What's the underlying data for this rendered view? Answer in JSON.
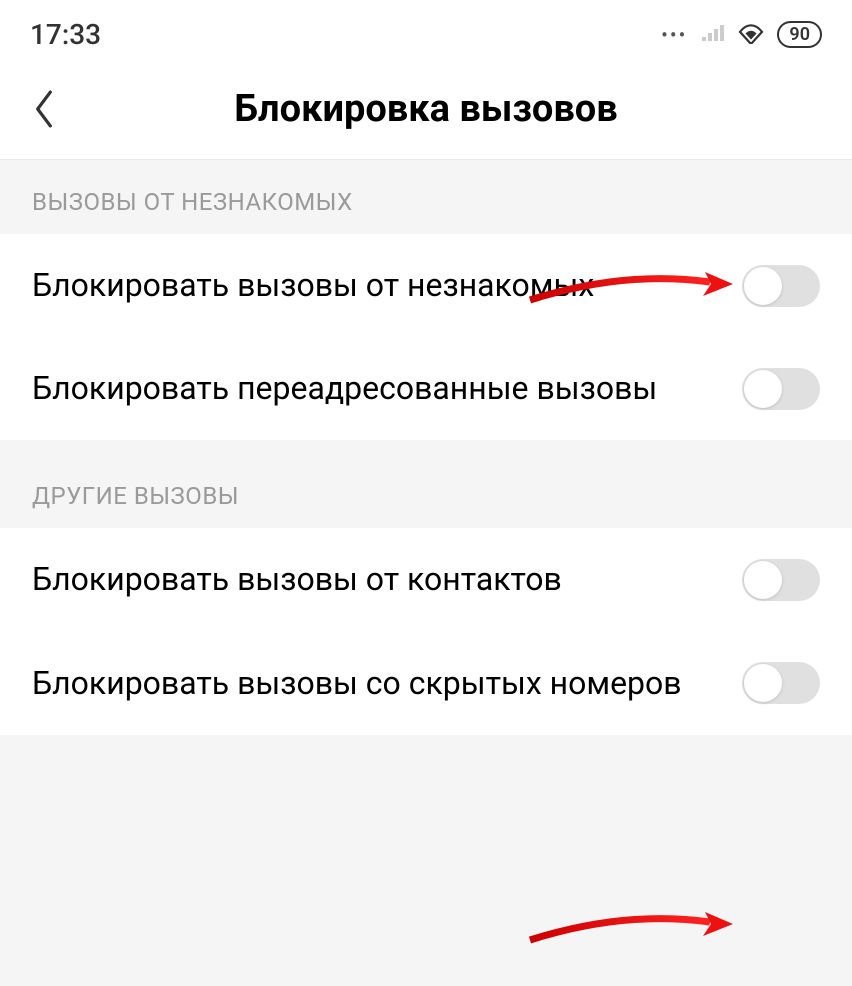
{
  "status_bar": {
    "time": "17:33",
    "battery": "90"
  },
  "header": {
    "title": "Блокировка вызовов"
  },
  "sections": [
    {
      "title": "ВЫЗОВЫ ОТ НЕЗНАКОМЫХ",
      "items": [
        {
          "label": "Блокировать вызовы от незнакомых",
          "enabled": false
        },
        {
          "label": "Блокировать переадресованные вызовы",
          "enabled": false
        }
      ]
    },
    {
      "title": "ДРУГИЕ ВЫЗОВЫ",
      "items": [
        {
          "label": "Блокировать вызовы от контактов",
          "enabled": false
        },
        {
          "label": "Блокировать вызовы со скрытых номеров",
          "enabled": false
        }
      ]
    }
  ]
}
